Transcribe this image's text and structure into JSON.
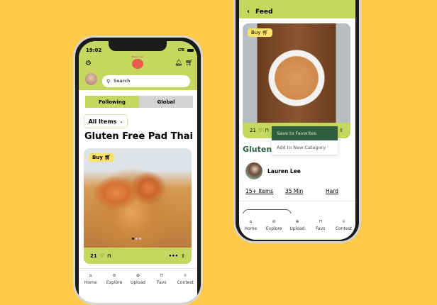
{
  "left_phone": {
    "status": {
      "time": "19:02",
      "network": "LTE"
    },
    "logo_text": "Make it up!",
    "search": {
      "placeholder": "Search"
    },
    "tabs": [
      {
        "label": "Following",
        "active": true
      },
      {
        "label": "Global",
        "active": false
      }
    ],
    "filter": {
      "selected": "All Items"
    },
    "title": "Gluten Free Pad Thai",
    "card": {
      "buy_label": "Buy",
      "likes": "21",
      "carousel_index": 1,
      "carousel_total": 3
    },
    "nav": [
      "Home",
      "Explore",
      "Upload",
      "Favs",
      "Contest"
    ]
  },
  "right_phone": {
    "header": {
      "title": "Feed"
    },
    "card": {
      "buy_label": "Buy",
      "likes": "21"
    },
    "menu": [
      "Save to Favorites",
      "Add to New Category"
    ],
    "title": "Gluten",
    "author": "Lauren Lee",
    "stats": [
      "15+ Items",
      "35 Min",
      "Hard"
    ],
    "nav": [
      "Home",
      "Explore",
      "Upload",
      "Favs",
      "Contest"
    ]
  },
  "colors": {
    "background": "#FFC94A",
    "accent": "#C5D75F",
    "dark_green": "#2E5E3E",
    "buy": "#FDE16B"
  }
}
